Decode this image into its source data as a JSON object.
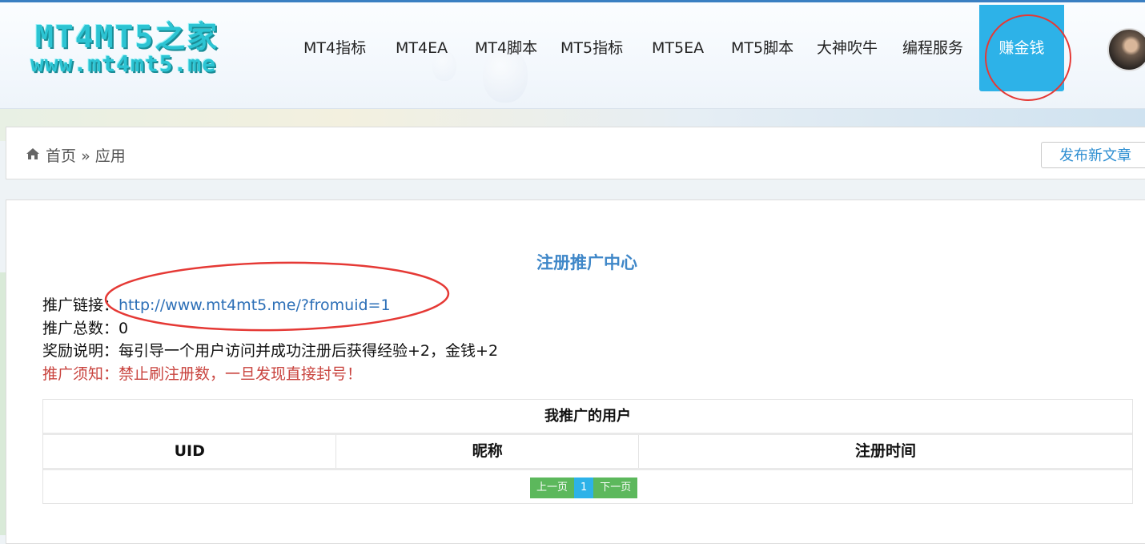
{
  "logo": {
    "line1": "MT4MT5之家",
    "line2": "www.mt4mt5.me"
  },
  "nav": {
    "items": [
      {
        "label": "MT4指标"
      },
      {
        "label": "MT4EA"
      },
      {
        "label": "MT4脚本"
      },
      {
        "label": "MT5指标"
      },
      {
        "label": "MT5EA"
      },
      {
        "label": "MT5脚本"
      },
      {
        "label": "大神吹牛"
      },
      {
        "label": "编程服务"
      },
      {
        "label": "赚金钱",
        "active": true
      }
    ]
  },
  "breadcrumb": {
    "home": "首页",
    "separator": "»",
    "current": "应用"
  },
  "publish_button": "发布新文章",
  "promo": {
    "title": "注册推广中心",
    "link_label": "推广链接：",
    "link_url": "http://www.mt4mt5.me/?fromuid=1",
    "total_label": "推广总数：",
    "total_value": "0",
    "reward_label": "奖励说明：",
    "reward_text": "每引导一个用户访问并成功注册后获得经验+2，金钱+2",
    "notice": "推广须知：禁止刷注册数，一旦发现直接封号！"
  },
  "table": {
    "caption": "我推广的用户",
    "columns": [
      "UID",
      "昵称",
      "注册时间"
    ],
    "pager": {
      "prev": "上一页",
      "current": "1",
      "next": "下一页"
    }
  },
  "colors": {
    "accent": "#2db2e8",
    "link": "#2c6fb7",
    "warning": "#c9443f",
    "annotation": "#e53935"
  }
}
